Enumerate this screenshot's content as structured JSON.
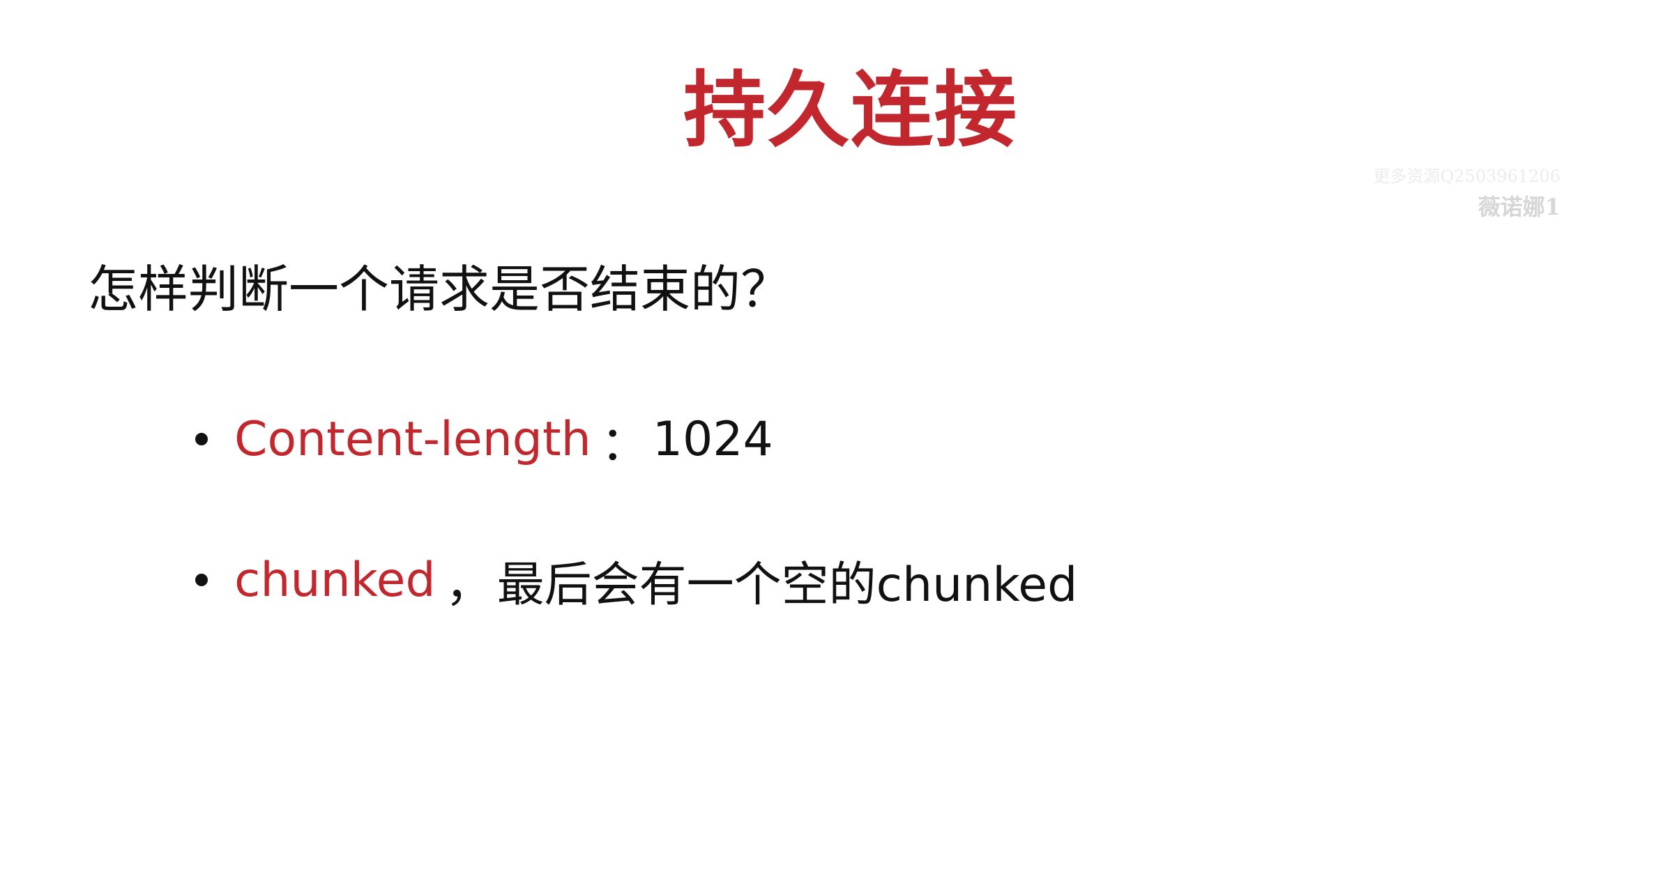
{
  "colors": {
    "accent": "#c1272d",
    "text": "#111111",
    "background": "#ffffff"
  },
  "slide": {
    "title": "持久连接",
    "watermark": {
      "line1": "更多资源Q2503961206",
      "line2": "薇诺娜1"
    },
    "question": "怎样判断一个请求是否结束的？",
    "bullets": [
      {
        "keyword": "Content-length",
        "separator": "：",
        "rest": "1024"
      },
      {
        "keyword": "chunked",
        "separator": "，",
        "rest": "最后会有一个空的chunked"
      }
    ]
  }
}
